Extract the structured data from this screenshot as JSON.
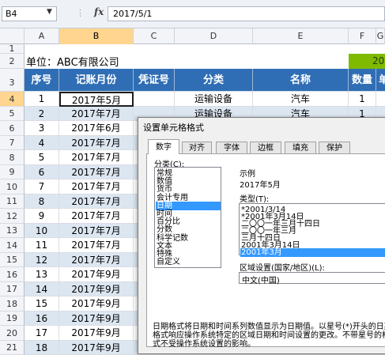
{
  "formula_bar": {
    "name_box": "B4",
    "fx_label": "fx",
    "cancel_label": "⋮",
    "formula_value": "2017/5/1"
  },
  "columns": [
    "A",
    "B",
    "C",
    "D",
    "E",
    "F",
    "G"
  ],
  "sheet": {
    "company_label": "单位：ABC有限公司",
    "green_cell_text": "20",
    "headers": [
      "序号",
      "记账月份",
      "凭证号",
      "分类",
      "名称",
      "数量",
      "单"
    ],
    "rows": [
      {
        "row": "4",
        "num": "1",
        "month": "2017年5月",
        "category": "运输设备",
        "name": "汽车",
        "qty": "1"
      },
      {
        "row": "5",
        "num": "2",
        "month": "2017年7月",
        "category": "运输设备",
        "name": "汽车",
        "qty": "1"
      },
      {
        "row": "6",
        "num": "3",
        "month": "2017年6月",
        "category": "",
        "name": "",
        "qty": ""
      },
      {
        "row": "7",
        "num": "4",
        "month": "2017年7月",
        "category": "",
        "name": "",
        "qty": ""
      },
      {
        "row": "8",
        "num": "5",
        "month": "2017年7月",
        "category": "",
        "name": "",
        "qty": ""
      },
      {
        "row": "9",
        "num": "6",
        "month": "2017年7月",
        "category": "",
        "name": "",
        "qty": ""
      },
      {
        "row": "10",
        "num": "7",
        "month": "2017年7月",
        "category": "",
        "name": "",
        "qty": ""
      },
      {
        "row": "11",
        "num": "8",
        "month": "2017年7月",
        "category": "",
        "name": "",
        "qty": ""
      },
      {
        "row": "12",
        "num": "9",
        "month": "2017年7月",
        "category": "",
        "name": "",
        "qty": ""
      },
      {
        "row": "13",
        "num": "10",
        "month": "2017年7月",
        "category": "",
        "name": "",
        "qty": ""
      },
      {
        "row": "14",
        "num": "11",
        "month": "2017年7月",
        "category": "",
        "name": "",
        "qty": ""
      },
      {
        "row": "15",
        "num": "12",
        "month": "2017年7月",
        "category": "",
        "name": "",
        "qty": ""
      },
      {
        "row": "16",
        "num": "13",
        "month": "2017年9月",
        "category": "",
        "name": "",
        "qty": ""
      },
      {
        "row": "17",
        "num": "14",
        "month": "2017年9月",
        "category": "",
        "name": "",
        "qty": ""
      },
      {
        "row": "18",
        "num": "15",
        "month": "2017年9月",
        "category": "",
        "name": "",
        "qty": ""
      },
      {
        "row": "19",
        "num": "16",
        "month": "2017年9月",
        "category": "",
        "name": "",
        "qty": ""
      },
      {
        "row": "20",
        "num": "17",
        "month": "2017年9月",
        "category": "",
        "name": "",
        "qty": ""
      },
      {
        "row": "21",
        "num": "18",
        "month": "2017年9月",
        "category": "",
        "name": "",
        "qty": ""
      }
    ],
    "row1": "1",
    "row2": "2",
    "row3": "3"
  },
  "dialog": {
    "title": "设置单元格格式",
    "tabs": [
      "数字",
      "对齐",
      "字体",
      "边框",
      "填充",
      "保护"
    ],
    "category_label": "分类(C):",
    "categories": [
      "常规",
      "数值",
      "货币",
      "会计专用",
      "日期",
      "时间",
      "百分比",
      "分数",
      "科学记数",
      "文本",
      "特殊",
      "自定义"
    ],
    "selected_category": "日期",
    "sample_label": "示例",
    "sample_value": "2017年5月",
    "type_label": "类型(T):",
    "types": [
      "*2001/3/14",
      "*2001年3月14日",
      "二〇〇一年三月十四日",
      "二〇〇一年三月",
      "三月十四日",
      "2001年3月14日",
      "2001年3月"
    ],
    "selected_type": "2001年3月",
    "locale_label": "区域设置(国家/地区)(L):",
    "locale_value": "中文(中国)",
    "description": "日期格式将日期和时间系列数值显示为日期值。以星号(*)开头的日期格式响应操作系统特定的区域日期和时间设置的更改。不带星号的格式不受操作系统设置的影响。"
  }
}
